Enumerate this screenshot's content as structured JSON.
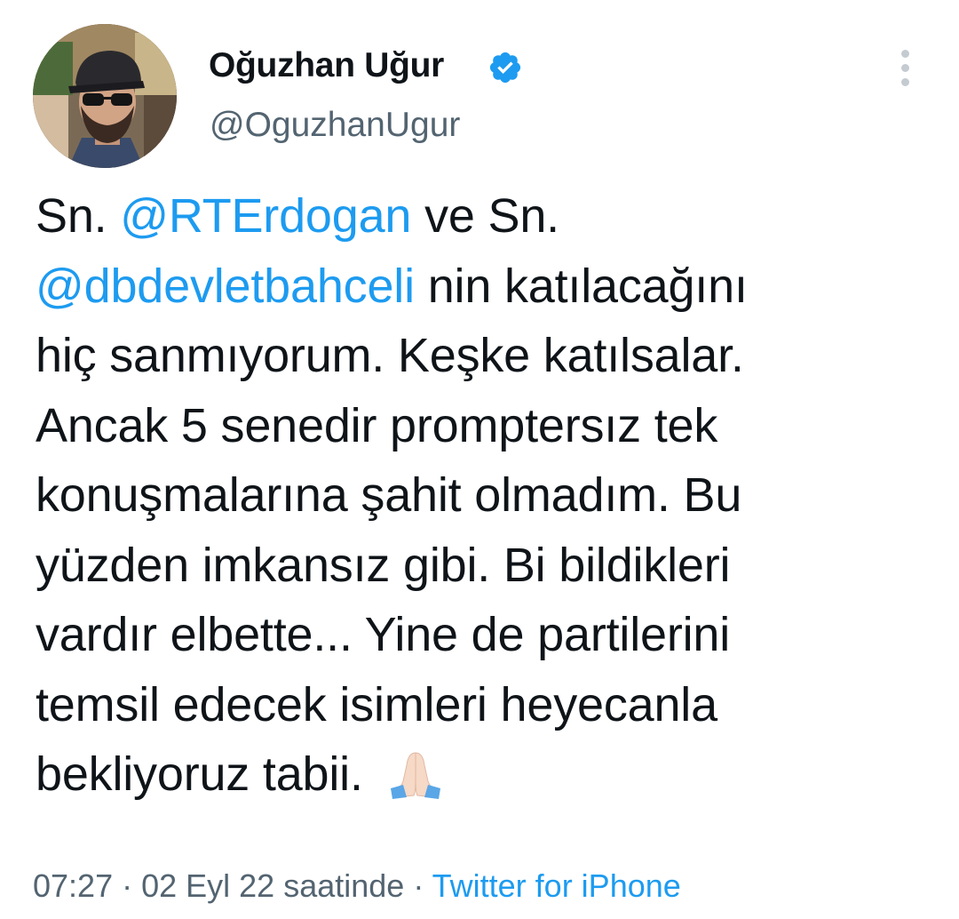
{
  "tweet": {
    "author": {
      "display_name": "Oğuzhan Uğur",
      "handle": "@OguzhanUgur",
      "verified_icon": "verified-badge-icon"
    },
    "more_icon": "more-vertical-icon",
    "lines": [
      [
        "Sn. ",
        "@RTErdogan",
        " ve Sn."
      ],
      [
        "@dbdevletbahceli",
        " nin katılacağını"
      ],
      [
        "hiç sanmıyorum. Keşke katılsalar."
      ],
      [
        "Ancak 5 senedir promptersız tek"
      ],
      [
        "konuşmalarına şahit olmadım. Bu"
      ],
      [
        "yüzden imkansız gibi. Bi bildikleri"
      ],
      [
        "vardır elbette... Yine de partilerini"
      ],
      [
        "temsil edecek isimleri heyecanla"
      ],
      [
        "bekliyoruz tabii. "
      ]
    ],
    "emoji_icon": "folded-hands-emoji",
    "meta": {
      "time": "07:27",
      "separator": " · ",
      "date": "02 Eyl 22 saatinde",
      "source": "Twitter for iPhone"
    },
    "colors": {
      "link": "#1d9bf0",
      "text": "#0f1419",
      "secondary": "#536471"
    }
  }
}
